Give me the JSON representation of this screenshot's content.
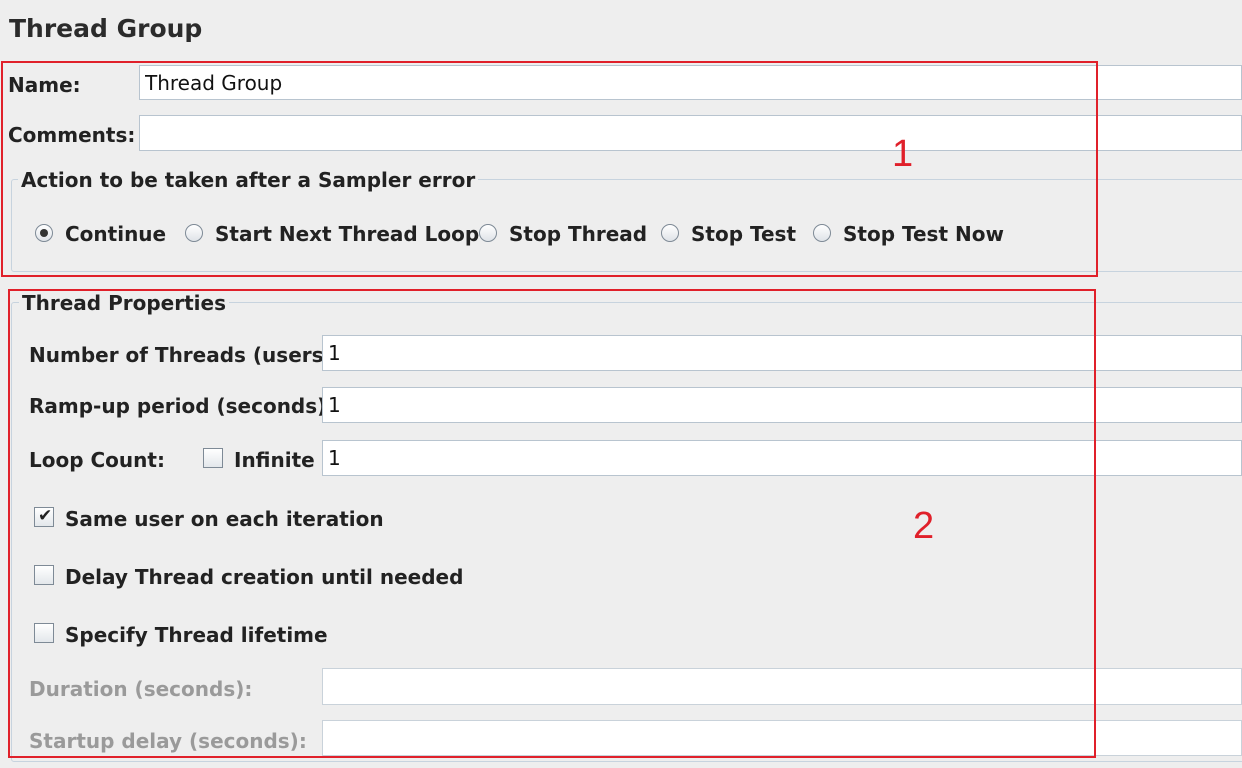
{
  "page_title": "Thread Group",
  "name_field": {
    "label": "Name:",
    "value": "Thread Group"
  },
  "comments_field": {
    "label": "Comments:",
    "value": ""
  },
  "sampler_error": {
    "legend": "Action to be taken after a Sampler error",
    "options": [
      {
        "label": "Continue",
        "selected": true
      },
      {
        "label": "Start Next Thread Loop",
        "selected": false
      },
      {
        "label": "Stop Thread",
        "selected": false
      },
      {
        "label": "Stop Test",
        "selected": false
      },
      {
        "label": "Stop Test Now",
        "selected": false
      }
    ]
  },
  "thread_properties": {
    "legend": "Thread Properties",
    "num_threads": {
      "label": "Number of Threads (users):",
      "value": "1"
    },
    "ramp_up": {
      "label": "Ramp-up period (seconds):",
      "value": "1"
    },
    "loop_count": {
      "label": "Loop Count:",
      "infinite_label": "Infinite",
      "infinite_checked": false,
      "value": "1"
    },
    "same_user": {
      "label": "Same user on each iteration",
      "checked": true
    },
    "delay_creation": {
      "label": "Delay Thread creation until needed",
      "checked": false
    },
    "specify_lifetime": {
      "label": "Specify Thread lifetime",
      "checked": false
    },
    "duration": {
      "label": "Duration (seconds):",
      "value": ""
    },
    "startup_delay": {
      "label": "Startup delay (seconds):",
      "value": ""
    }
  },
  "annotations": {
    "box1": "1",
    "box2": "2"
  },
  "colors": {
    "annotation": "#e0202a",
    "background": "#eeeeee",
    "disabled_text": "#9a9a9a"
  }
}
